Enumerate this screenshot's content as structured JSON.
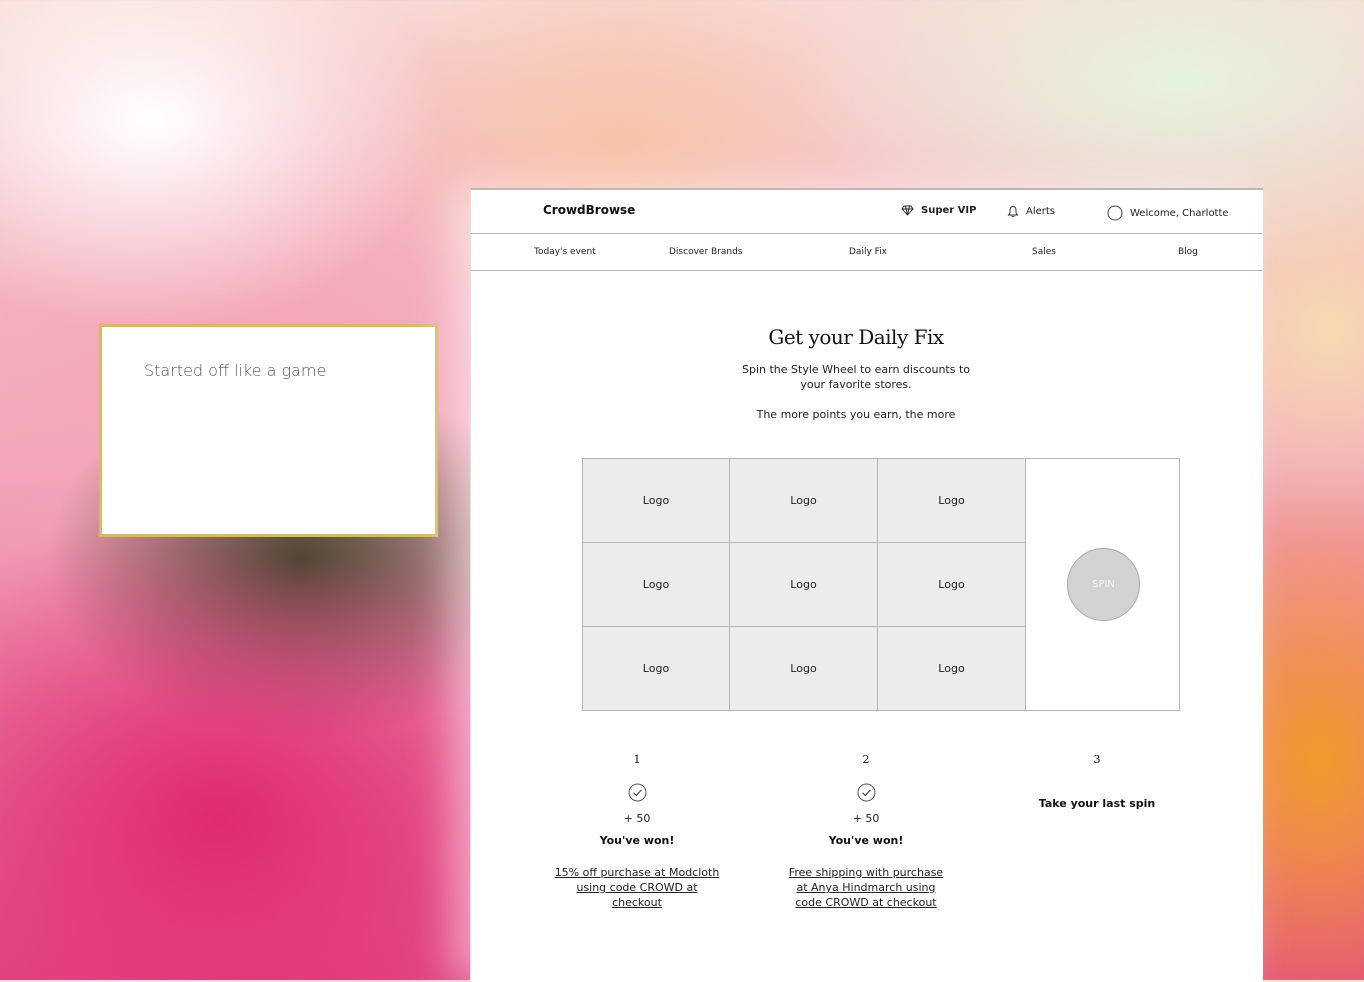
{
  "note": {
    "text": "Started off like a game"
  },
  "app": {
    "brand": "CrowdBrowse",
    "top": {
      "vip": "Super VIP",
      "alerts": "Alerts",
      "welcome": "Welcome, Charlotte"
    },
    "nav": [
      "Today's event",
      "Discover Brands",
      "Daily Fix",
      "Sales",
      "Blog"
    ],
    "hero": {
      "title": "Get your Daily Fix",
      "subtitle": "Spin the Style Wheel to earn discounts to your favorite stores.",
      "more": "The more points you earn, the more"
    },
    "wheel": {
      "logos": [
        "Logo",
        "Logo",
        "Logo",
        "Logo",
        "Logo",
        "Logo",
        "Logo",
        "Logo",
        "Logo"
      ],
      "spin_label": "SPIN"
    },
    "steps": [
      {
        "num": "1",
        "points": "+ 50",
        "result": "You've won!",
        "prize": "15% off purchase at Modcloth using code CROWD at checkout"
      },
      {
        "num": "2",
        "points": "+ 50",
        "result": "You've won!",
        "prize": "Free shipping with purchase at Anya Hindmarch using code CROWD at checkout"
      },
      {
        "num": "3",
        "action": "Take your last spin"
      }
    ]
  },
  "icons": {
    "vip": "diamond-icon",
    "alerts": "bell-icon",
    "welcome": "avatar-circle-icon",
    "check": "check-circle-icon"
  }
}
